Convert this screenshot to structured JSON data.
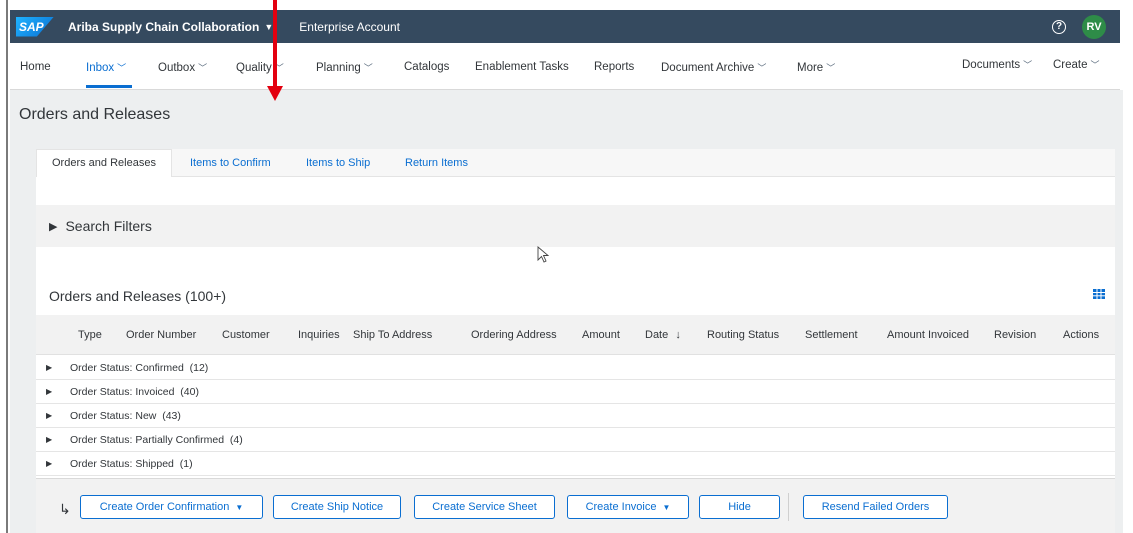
{
  "shell": {
    "logo": "SAP",
    "app_title": "Ariba Supply Chain Collaboration",
    "account": "Enterprise Account",
    "avatar_initials": "RV"
  },
  "nav": {
    "items": [
      {
        "label": "Home"
      },
      {
        "label": "Inbox"
      },
      {
        "label": "Outbox"
      },
      {
        "label": "Quality"
      },
      {
        "label": "Planning"
      },
      {
        "label": "Catalogs"
      },
      {
        "label": "Enablement Tasks"
      },
      {
        "label": "Reports"
      },
      {
        "label": "Document Archive"
      },
      {
        "label": "More"
      },
      {
        "label": "Documents"
      },
      {
        "label": "Create"
      }
    ]
  },
  "page": {
    "title": "Orders and Releases",
    "tabs": [
      "Orders and Releases",
      "Items to Confirm",
      "Items to Ship",
      "Return Items"
    ],
    "search_filters": "Search Filters",
    "list_title": "Orders and Releases (100+)"
  },
  "table": {
    "columns": [
      "Type",
      "Order Number",
      "Customer",
      "Inquiries",
      "Ship To Address",
      "Ordering Address",
      "Amount",
      "Date",
      "Routing Status",
      "Settlement",
      "Amount Invoiced",
      "Revision",
      "Actions"
    ],
    "date_sort_indicator": "↓",
    "groups": [
      "Order Status: Confirmed  (12)",
      "Order Status: Invoiced  (40)",
      "Order Status: New  (43)",
      "Order Status: Partially Confirmed  (4)",
      "Order Status: Shipped  (1)"
    ]
  },
  "footer": {
    "buttons": [
      "Create Order Confirmation",
      "Create Ship Notice",
      "Create Service Sheet",
      "Create Invoice",
      "Hide",
      "Resend Failed Orders"
    ]
  },
  "colors": {
    "shell": "#354a5f",
    "accent": "#0a6ed1",
    "annotation_arrow": "#e3000f"
  }
}
